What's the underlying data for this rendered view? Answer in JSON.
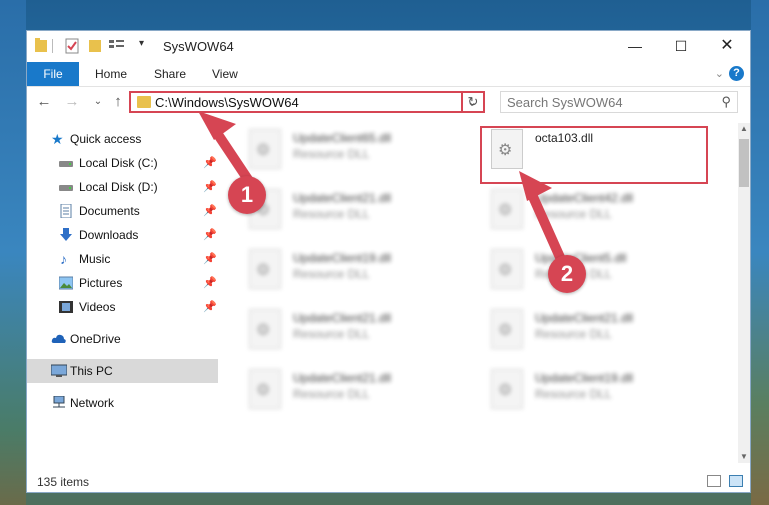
{
  "window": {
    "title": "SysWOW64"
  },
  "ribbon": {
    "tabs": [
      "File",
      "Home",
      "Share",
      "View"
    ]
  },
  "address": {
    "path": "C:\\Windows\\SysWOW64"
  },
  "search": {
    "placeholder": "Search SysWOW64"
  },
  "sidebar": {
    "items": [
      {
        "label": "Quick access",
        "icon": "star-icon",
        "pinned": false
      },
      {
        "label": "Local Disk (C:)",
        "icon": "drive-icon",
        "pinned": true
      },
      {
        "label": "Local Disk (D:)",
        "icon": "drive-icon",
        "pinned": true
      },
      {
        "label": "Documents",
        "icon": "documents-icon",
        "pinned": true
      },
      {
        "label": "Downloads",
        "icon": "downloads-icon",
        "pinned": true
      },
      {
        "label": "Music",
        "icon": "music-icon",
        "pinned": true
      },
      {
        "label": "Pictures",
        "icon": "pictures-icon",
        "pinned": true
      },
      {
        "label": "Videos",
        "icon": "videos-icon",
        "pinned": true
      },
      {
        "label": "OneDrive",
        "icon": "cloud-icon",
        "pinned": false
      },
      {
        "label": "This PC",
        "icon": "computer-icon",
        "pinned": false,
        "selected": true
      },
      {
        "label": "Network",
        "icon": "network-icon",
        "pinned": false
      }
    ]
  },
  "files": [
    {
      "name": "UpdateClient65.dll",
      "type": "Resource DLL"
    },
    {
      "name": "octa103.dll",
      "type": ""
    },
    {
      "name": "UpdateClient21.dll",
      "type": "Resource DLL"
    },
    {
      "name": "UpdateClient42.dll",
      "type": "Resource DLL"
    },
    {
      "name": "UpdateClient19.dll",
      "type": "Resource DLL"
    },
    {
      "name": "UpdateClient5.dll",
      "type": "Resource DLL"
    },
    {
      "name": "UpdateClient21.dll",
      "type": "Resource DLL"
    },
    {
      "name": "UpdateClient21.dll",
      "type": "Resource DLL"
    },
    {
      "name": "UpdateClient21.dll",
      "type": "Resource DLL"
    },
    {
      "name": "UpdateClient19.dll",
      "type": "Resource DLL"
    }
  ],
  "status": {
    "item_count": "135 items"
  },
  "annotations": {
    "step1": "1",
    "step2": "2"
  },
  "colors": {
    "accent": "#1979ca",
    "highlight": "#d64553",
    "selected": "#d9d9d9"
  }
}
